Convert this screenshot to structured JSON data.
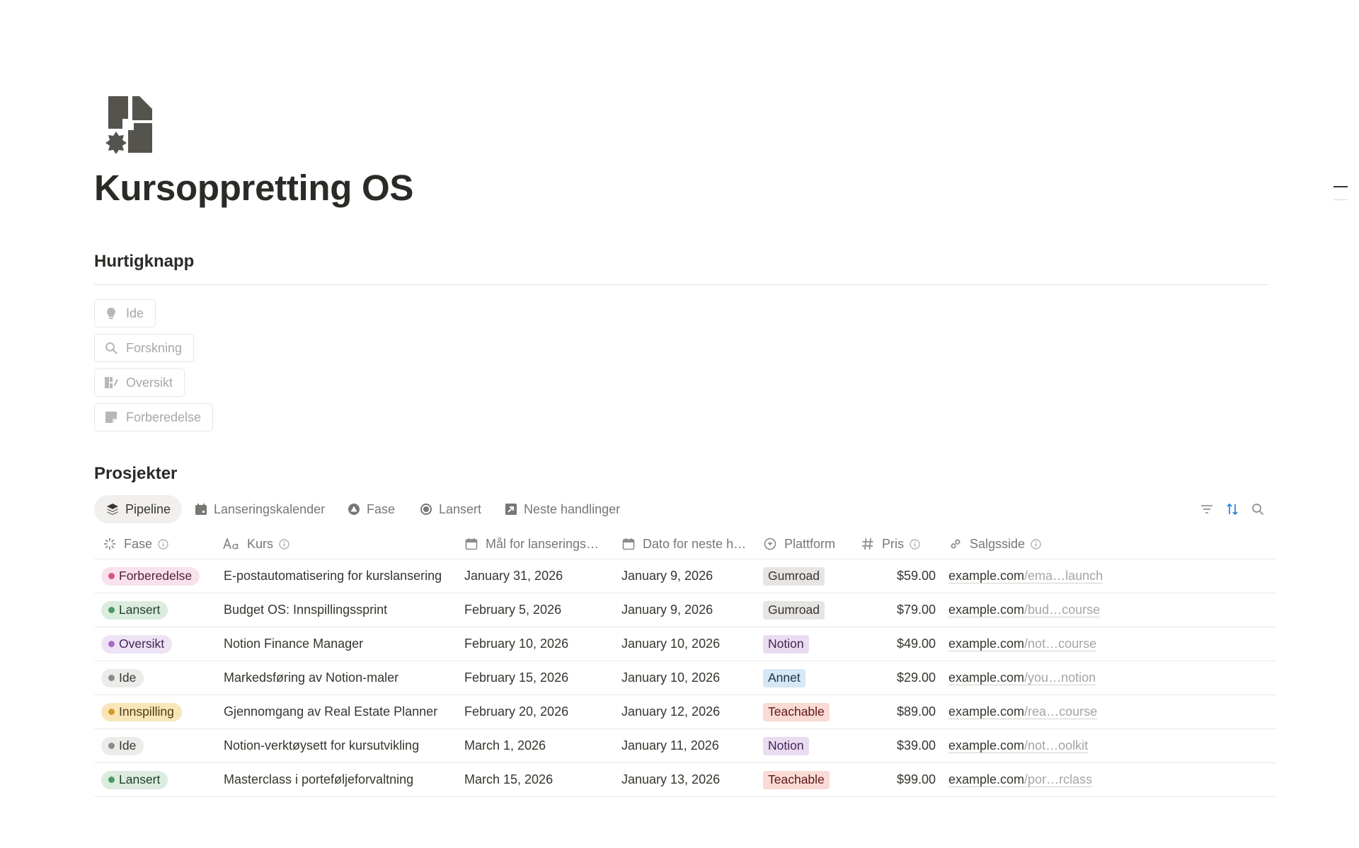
{
  "page": {
    "title": "Kursoppretting OS",
    "icon": "course-puzzle-icon"
  },
  "quick_buttons": {
    "heading": "Hurtigknapp",
    "items": [
      {
        "label": "Ide",
        "icon": "lightbulb-icon"
      },
      {
        "label": "Forskning",
        "icon": "search-icon"
      },
      {
        "label": "Oversikt",
        "icon": "outline-edit-icon"
      },
      {
        "label": "Forberedelse",
        "icon": "note-icon"
      }
    ]
  },
  "projects": {
    "heading": "Prosjekter",
    "tabs": [
      {
        "label": "Pipeline",
        "icon": "layers-icon",
        "active": true
      },
      {
        "label": "Lanseringskalender",
        "icon": "calendar-icon",
        "active": false
      },
      {
        "label": "Fase",
        "icon": "triangle-circle-icon",
        "active": false
      },
      {
        "label": "Lansert",
        "icon": "circle-icon",
        "active": false
      },
      {
        "label": "Neste handlinger",
        "icon": "arrow-box-icon",
        "active": false
      }
    ],
    "toolbar": [
      "filter-icon",
      "sort-icon",
      "search-icon"
    ],
    "columns": {
      "fase": "Fase",
      "kurs": "Kurs",
      "mal": "Mål for lanserings…",
      "dato": "Dato for neste h…",
      "plattform": "Plattform",
      "pris": "Pris",
      "salgsside": "Salgsside"
    },
    "rows": [
      {
        "fase": "Forberedelse",
        "kurs": "E-postautomatisering for kurslansering",
        "mal": "January 31, 2026",
        "dato": "January 9, 2026",
        "plattform": "Gumroad",
        "pris": "$59.00",
        "link_domain": "example.com",
        "link_rest": "/ema…launch"
      },
      {
        "fase": "Lansert",
        "kurs": "Budget OS: Innspillingssprint",
        "mal": "February 5, 2026",
        "dato": "January 9, 2026",
        "plattform": "Gumroad",
        "pris": "$79.00",
        "link_domain": "example.com",
        "link_rest": "/bud…course"
      },
      {
        "fase": "Oversikt",
        "kurs": "Notion Finance Manager",
        "mal": "February 10, 2026",
        "dato": "January 10, 2026",
        "plattform": "Notion",
        "pris": "$49.00",
        "link_domain": "example.com",
        "link_rest": "/not…course"
      },
      {
        "fase": "Ide",
        "kurs": "Markedsføring av Notion-maler",
        "mal": "February 15, 2026",
        "dato": "January 10, 2026",
        "plattform": "Annet",
        "pris": "$29.00",
        "link_domain": "example.com",
        "link_rest": "/you…notion"
      },
      {
        "fase": "Innspilling",
        "kurs": "Gjennomgang av Real Estate Planner",
        "mal": "February 20, 2026",
        "dato": "January 12, 2026",
        "plattform": "Teachable",
        "pris": "$89.00",
        "link_domain": "example.com",
        "link_rest": "/rea…course"
      },
      {
        "fase": "Ide",
        "kurs": "Notion-verktøysett for kursutvikling",
        "mal": "March 1, 2026",
        "dato": "January 11, 2026",
        "plattform": "Notion",
        "pris": "$39.00",
        "link_domain": "example.com",
        "link_rest": "/not…oolkit"
      },
      {
        "fase": "Lansert",
        "kurs": "Masterclass i porteføljeforvaltning",
        "mal": "March 15, 2026",
        "dato": "January 13, 2026",
        "plattform": "Teachable",
        "pris": "$99.00",
        "link_domain": "example.com",
        "link_rest": "/por…rclass"
      }
    ]
  },
  "colors": {
    "status": {
      "Forberedelse": {
        "bg": "#f9e2ec",
        "dot": "#d4548d",
        "text": "#4c2337"
      },
      "Lansert": {
        "bg": "#dcecdf",
        "dot": "#4b9a63",
        "text": "#1f3d28"
      },
      "Oversikt": {
        "bg": "#eee3f4",
        "dot": "#a66bc6",
        "text": "#412454"
      },
      "Ide": {
        "bg": "#ebebea",
        "dot": "#8c8b88",
        "text": "#37352f"
      },
      "Innspilling": {
        "bg": "#f8e6b9",
        "dot": "#d59b25",
        "text": "#4d3a12"
      }
    },
    "platform": {
      "Gumroad": {
        "bg": "#e6e5e3",
        "text": "#37352f"
      },
      "Notion": {
        "bg": "#eadcf0",
        "text": "#412454"
      },
      "Annet": {
        "bg": "#d6e7f5",
        "text": "#183347"
      },
      "Teachable": {
        "bg": "#fadad5",
        "text": "#5d1715"
      }
    },
    "accent_sort": "#2383e2"
  }
}
